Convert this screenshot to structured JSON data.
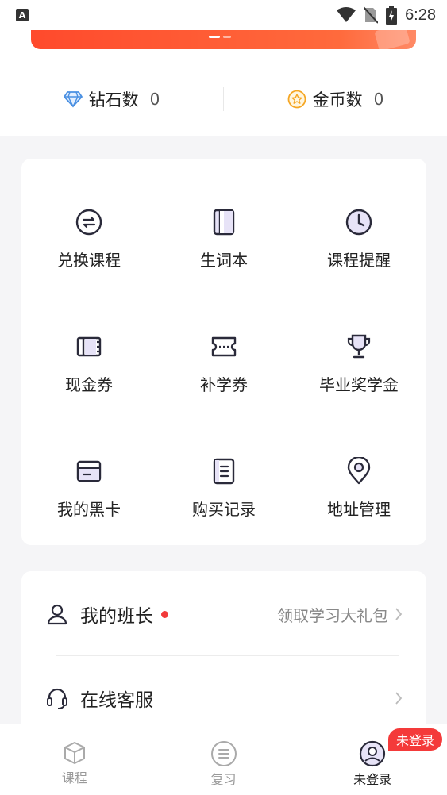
{
  "status_bar": {
    "left_icon": "A",
    "time": "6:28"
  },
  "stats": [
    {
      "label": "钻石数",
      "value": "0",
      "icon": "diamond-icon"
    },
    {
      "label": "金币数",
      "value": "0",
      "icon": "coin-star-icon"
    }
  ],
  "grid": [
    {
      "label": "兑换课程",
      "icon": "exchange-icon"
    },
    {
      "label": "生词本",
      "icon": "notebook-icon"
    },
    {
      "label": "课程提醒",
      "icon": "clock-icon"
    },
    {
      "label": "现金券",
      "icon": "cash-voucher-icon"
    },
    {
      "label": "补学券",
      "icon": "ticket-icon"
    },
    {
      "label": "毕业奖学金",
      "icon": "trophy-icon"
    },
    {
      "label": "我的黑卡",
      "icon": "card-icon"
    },
    {
      "label": "购买记录",
      "icon": "record-icon"
    },
    {
      "label": "地址管理",
      "icon": "location-icon"
    }
  ],
  "list": {
    "monitor_label": "我的班长",
    "monitor_right": "领取学习大礼包",
    "service_label": "在线客服"
  },
  "tabs": [
    {
      "label": "课程",
      "icon": "cube-icon"
    },
    {
      "label": "复习",
      "icon": "review-icon"
    },
    {
      "label": "未登录",
      "icon": "user-avatar-icon"
    }
  ],
  "login_badge": "未登录",
  "colors": {
    "accent": "#f43a3a",
    "diamond": "#4a90e2",
    "coin": "#f5a623",
    "icon_stroke": "#2a2a3a"
  }
}
